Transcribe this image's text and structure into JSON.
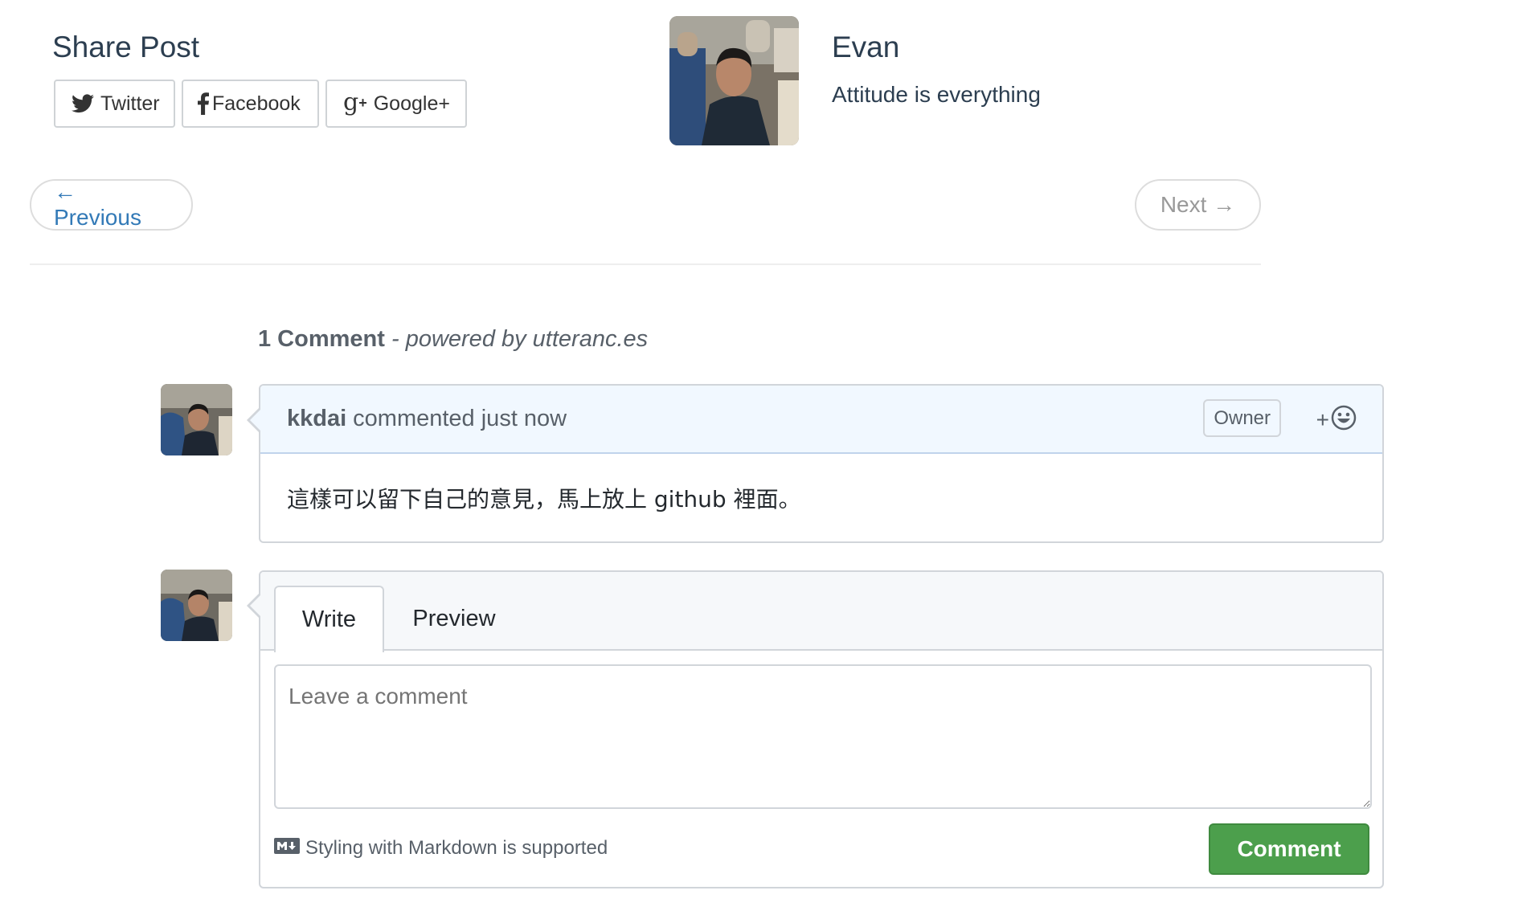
{
  "share": {
    "title": "Share Post",
    "buttons": [
      {
        "label": "Twitter",
        "icon": "twitter-icon"
      },
      {
        "label": "Facebook",
        "icon": "facebook-icon"
      },
      {
        "label": "Google+",
        "icon": "google-plus-icon"
      }
    ]
  },
  "author": {
    "name": "Evan",
    "bio": "Attitude is everything"
  },
  "pager": {
    "prev": "← Previous",
    "next": "Next →"
  },
  "comments": {
    "count_label": "1 Comment",
    "powered_by": "- powered by utteranc.es",
    "items": [
      {
        "user": "kkdai",
        "meta": "commented just now",
        "badge": "Owner",
        "body": "這樣可以留下自己的意見，馬上放上 github 裡面。"
      }
    ],
    "reaction_plus": "+"
  },
  "editor": {
    "tab_write": "Write",
    "tab_preview": "Preview",
    "placeholder": "Leave a comment",
    "markdown_note": "Styling with Markdown is supported",
    "submit": "Comment"
  },
  "colors": {
    "link": "#337ab7",
    "header_bg": "#f1f8ff",
    "submit_bg": "#4c9f4c"
  }
}
